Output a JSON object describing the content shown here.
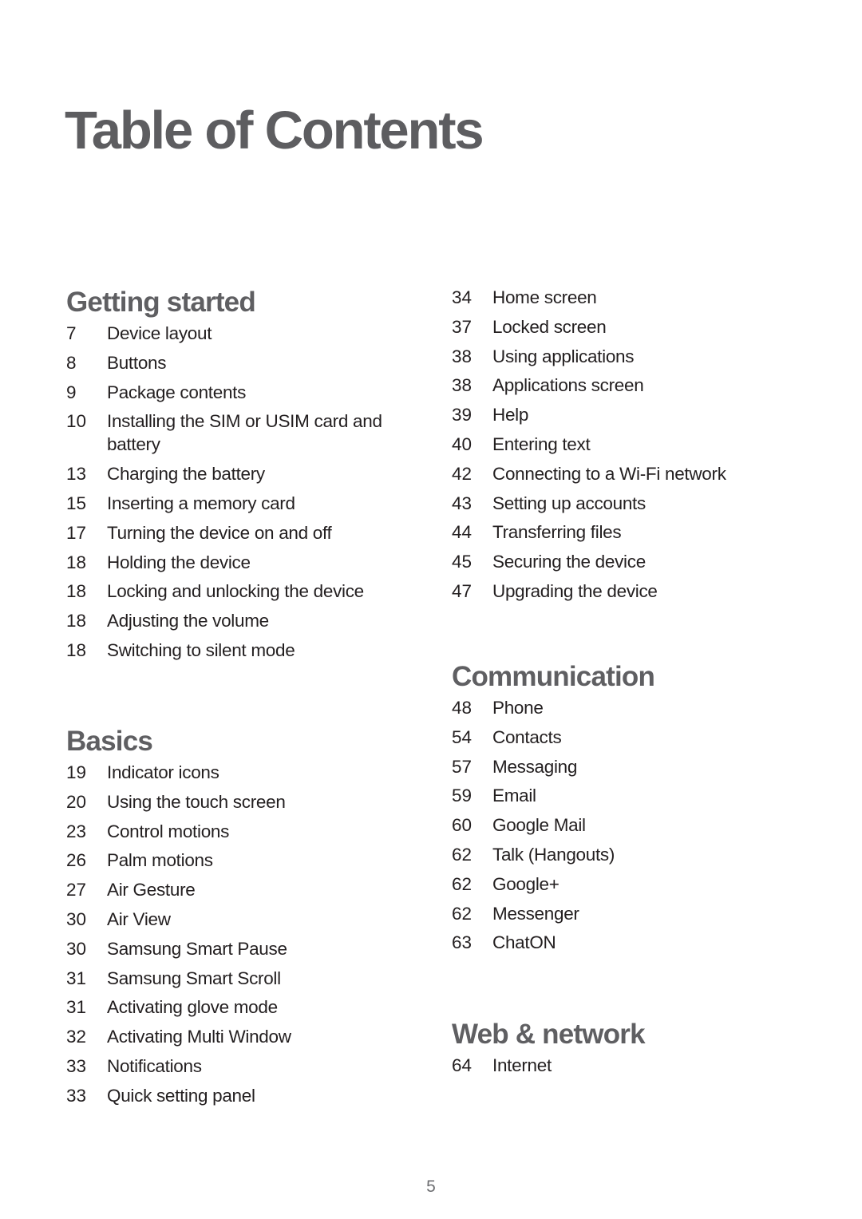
{
  "title": "Table of Contents",
  "page_number": "5",
  "sections": {
    "getting_started": {
      "title": "Getting started",
      "entries": [
        {
          "page": "7",
          "text": "Device layout"
        },
        {
          "page": "8",
          "text": "Buttons"
        },
        {
          "page": "9",
          "text": "Package contents"
        },
        {
          "page": "10",
          "text": "Installing the SIM or USIM card and battery"
        },
        {
          "page": "13",
          "text": "Charging the battery"
        },
        {
          "page": "15",
          "text": "Inserting a memory card"
        },
        {
          "page": "17",
          "text": "Turning the device on and off"
        },
        {
          "page": "18",
          "text": "Holding the device"
        },
        {
          "page": "18",
          "text": "Locking and unlocking the device"
        },
        {
          "page": "18",
          "text": "Adjusting the volume"
        },
        {
          "page": "18",
          "text": "Switching to silent mode"
        }
      ]
    },
    "basics": {
      "title": "Basics",
      "entries": [
        {
          "page": "19",
          "text": "Indicator icons"
        },
        {
          "page": "20",
          "text": "Using the touch screen"
        },
        {
          "page": "23",
          "text": "Control motions"
        },
        {
          "page": "26",
          "text": "Palm motions"
        },
        {
          "page": "27",
          "text": "Air Gesture"
        },
        {
          "page": "30",
          "text": "Air View"
        },
        {
          "page": "30",
          "text": "Samsung Smart Pause"
        },
        {
          "page": "31",
          "text": "Samsung Smart Scroll"
        },
        {
          "page": "31",
          "text": "Activating glove mode"
        },
        {
          "page": "32",
          "text": "Activating Multi Window"
        },
        {
          "page": "33",
          "text": "Notifications"
        },
        {
          "page": "33",
          "text": "Quick setting panel"
        }
      ]
    },
    "basics_continued": {
      "entries": [
        {
          "page": "34",
          "text": "Home screen"
        },
        {
          "page": "37",
          "text": "Locked screen"
        },
        {
          "page": "38",
          "text": "Using applications"
        },
        {
          "page": "38",
          "text": "Applications screen"
        },
        {
          "page": "39",
          "text": "Help"
        },
        {
          "page": "40",
          "text": "Entering text"
        },
        {
          "page": "42",
          "text": "Connecting to a Wi-Fi network"
        },
        {
          "page": "43",
          "text": "Setting up accounts"
        },
        {
          "page": "44",
          "text": "Transferring files"
        },
        {
          "page": "45",
          "text": "Securing the device"
        },
        {
          "page": "47",
          "text": "Upgrading the device"
        }
      ]
    },
    "communication": {
      "title": "Communication",
      "entries": [
        {
          "page": "48",
          "text": "Phone"
        },
        {
          "page": "54",
          "text": "Contacts"
        },
        {
          "page": "57",
          "text": "Messaging"
        },
        {
          "page": "59",
          "text": "Email"
        },
        {
          "page": "60",
          "text": "Google Mail"
        },
        {
          "page": "62",
          "text": "Talk (Hangouts)"
        },
        {
          "page": "62",
          "text": "Google+"
        },
        {
          "page": "62",
          "text": "Messenger"
        },
        {
          "page": "63",
          "text": "ChatON"
        }
      ]
    },
    "web_network": {
      "title": "Web & network",
      "entries": [
        {
          "page": "64",
          "text": "Internet"
        }
      ]
    }
  }
}
